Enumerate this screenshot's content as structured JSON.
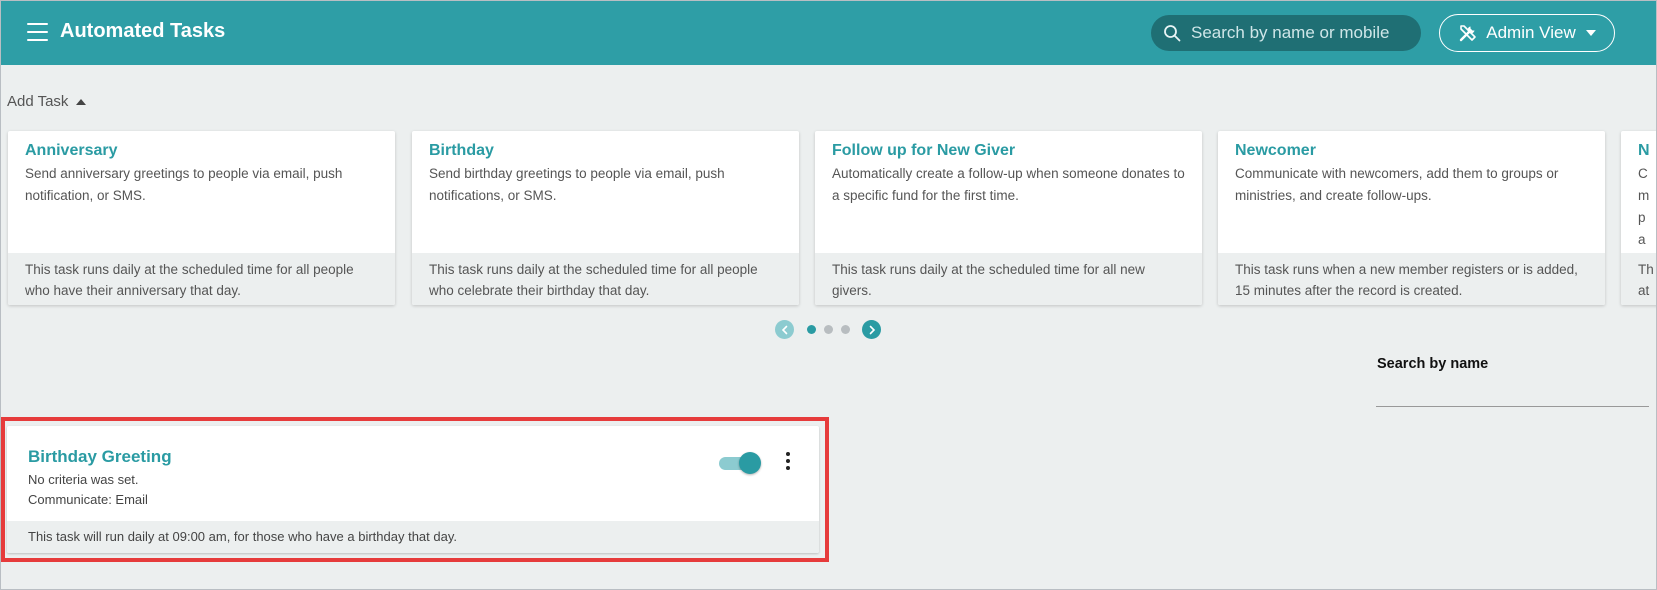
{
  "header": {
    "title": "Automated Tasks",
    "search_placeholder": "Search by name or mobile",
    "admin_view_label": "Admin View"
  },
  "add_task": {
    "label": "Add Task"
  },
  "carousel": {
    "cards": [
      {
        "title": "Anniversary",
        "description": "Send anniversary greetings to people via email, push notification, or SMS.",
        "footer": "This task runs daily at the scheduled time for all people who have their anniversary that day."
      },
      {
        "title": "Birthday",
        "description": "Send birthday greetings to people via email, push notifications, or SMS.",
        "footer": "This task runs daily at the scheduled time for all people who celebrate their birthday that day."
      },
      {
        "title": "Follow up for New Giver",
        "description": "Automatically create a follow-up when someone donates to a specific fund for the first time.",
        "footer": "This task runs daily at the scheduled time for all new givers."
      },
      {
        "title": "Newcomer",
        "description": "Communicate with newcomers, add them to groups or ministries, and create follow-ups.",
        "footer": "This task runs when a new member registers or is added, 15 minutes after the record is created."
      },
      {
        "title": "N",
        "description": "C m p a",
        "footer": "Th at"
      }
    ],
    "pages": 3,
    "active_page": 1
  },
  "name_search": {
    "label": "Search by name",
    "placeholder": ""
  },
  "task": {
    "title": "Birthday Greeting",
    "criteria": "No criteria was set.",
    "communicate": "Communicate: Email",
    "footer": "This task will run daily at 09:00 am, for those who have a birthday that day.",
    "enabled": true
  },
  "colors": {
    "header_bg": "#2e9ea6",
    "accent": "#2a9ba3",
    "highlight_border": "#e63b3b",
    "page_bg": "#ecefef"
  }
}
